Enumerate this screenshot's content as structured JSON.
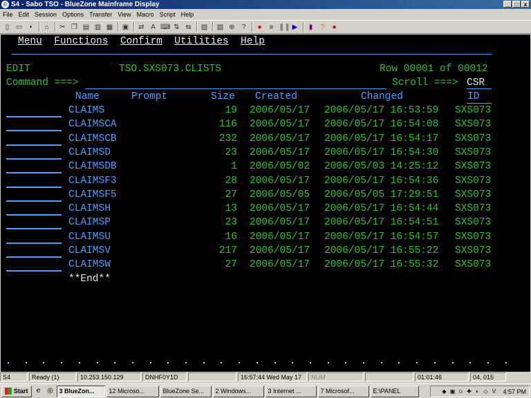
{
  "window": {
    "title": "S4 - Sabo TSO - BlueZone Mainframe Display",
    "app_icon": "bluezone-icon",
    "buttons": [
      "_",
      "□",
      "x"
    ]
  },
  "menubar": [
    "File",
    "Edit",
    "Session",
    "Options",
    "Transfer",
    "View",
    "Macro",
    "Script",
    "Help"
  ],
  "toolbar_icons": [
    "new-icon",
    "open-icon",
    "save-icon",
    "sep",
    "home-icon",
    "sep",
    "cut-icon",
    "copy-icon",
    "paste-icon",
    "print-icon",
    "print-screen-icon",
    "sep",
    "display-icon",
    "sep",
    "connect-icon",
    "font-icon",
    "keyboard-icon",
    "transfer-icon",
    "transfer2-icon",
    "sep",
    "clipboard-icon",
    "sep",
    "capture-icon",
    "zoom-icon",
    "find-icon",
    "sep",
    "record-icon",
    "stop-icon",
    "pause-icon",
    "play-icon",
    "sep",
    "book-icon",
    "help-icon",
    "apple-icon"
  ],
  "terminal": {
    "menu": [
      "Menu",
      "Functions",
      "Confirm",
      "Utilities",
      "Help"
    ],
    "mode": "EDIT",
    "dataset": "TSO.SXS073.CLISTS",
    "row_label": "Row 00001 of 00012",
    "command_label": "Command ===>",
    "scroll_label": "Scroll ===>",
    "scroll_value": "CSR",
    "columns": [
      "Name",
      "Prompt",
      "Size",
      "Created",
      "Changed",
      "ID"
    ],
    "members": [
      {
        "name": "CLAIMS",
        "size": "19",
        "created": "2006/05/17",
        "changed": "2006/05/17 16:53:59",
        "id": "SXS073"
      },
      {
        "name": "CLAIMSCA",
        "size": "116",
        "created": "2006/05/17",
        "changed": "2006/05/17 16:54:08",
        "id": "SXS073"
      },
      {
        "name": "CLAIMSCB",
        "size": "232",
        "created": "2006/05/17",
        "changed": "2006/05/17 16:54:17",
        "id": "SXS073"
      },
      {
        "name": "CLAIMSD",
        "size": "23",
        "created": "2006/05/17",
        "changed": "2006/05/17 16:54:30",
        "id": "SXS073"
      },
      {
        "name": "CLAIMSDB",
        "size": "1",
        "created": "2006/05/02",
        "changed": "2006/05/03 14:25:12",
        "id": "SXS073"
      },
      {
        "name": "CLAIMSF3",
        "size": "28",
        "created": "2006/05/17",
        "changed": "2006/05/17 16:54:36",
        "id": "SXS073"
      },
      {
        "name": "CLAIMSF5",
        "size": "27",
        "created": "2006/05/05",
        "changed": "2006/05/05 17:29:51",
        "id": "SXS073"
      },
      {
        "name": "CLAIMSH",
        "size": "13",
        "created": "2006/05/17",
        "changed": "2006/05/17 16:54:44",
        "id": "SXS073"
      },
      {
        "name": "CLAIMSP",
        "size": "23",
        "created": "2006/05/17",
        "changed": "2006/05/17 16:54:51",
        "id": "SXS073"
      },
      {
        "name": "CLAIMSU",
        "size": "16",
        "created": "2006/05/17",
        "changed": "2006/05/17 16:54:57",
        "id": "SXS073"
      },
      {
        "name": "CLAIMSV",
        "size": "217",
        "created": "2006/05/17",
        "changed": "2006/05/17 16:55:22",
        "id": "SXS073"
      },
      {
        "name": "CLAIMSW",
        "size": "27",
        "created": "2006/05/17",
        "changed": "2006/05/17 16:55:32",
        "id": "SXS073"
      }
    ],
    "end_marker": "**End**"
  },
  "statusbar": [
    "S4",
    "Ready (1)",
    "10.253.150.129",
    "DNHF0Y1D",
    "",
    "16:57:44  Wed May 17",
    "NUM",
    "",
    "01:01:46",
    "04, 015"
  ],
  "taskbar": {
    "start": "Start",
    "tasks": [
      "3 BlueZon...",
      "12 Microso...",
      "BlueZone Se...",
      "2 Windows...",
      "3 Internet ...",
      "7 Microsof...",
      "E:\\PANEL"
    ],
    "active_index": 0,
    "clock": "4:57 PM"
  },
  "colors": {
    "screen_bg": "#000000",
    "field_blue": "#4f9fff",
    "text_green": "#2fc02f",
    "text_white": "#e8e8e8"
  }
}
